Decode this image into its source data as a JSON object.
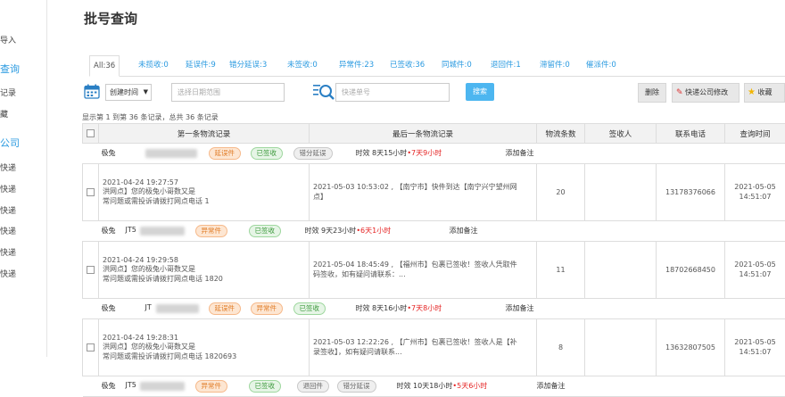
{
  "sidebar": {
    "items": [
      {
        "label": "导入",
        "type": "item"
      },
      {
        "label": "查询",
        "type": "head"
      },
      {
        "label": "记录",
        "type": "item"
      },
      {
        "label": "藏",
        "type": "item"
      },
      {
        "label": "公司",
        "type": "head"
      },
      {
        "label": "快递",
        "type": "item"
      },
      {
        "label": "快递",
        "type": "item"
      },
      {
        "label": "快递",
        "type": "item"
      },
      {
        "label": "快递",
        "type": "item"
      },
      {
        "label": "快递",
        "type": "item"
      },
      {
        "label": "快递",
        "type": "item"
      }
    ]
  },
  "page_title": "批号查询",
  "tabs": [
    {
      "label": "All:36",
      "active": true
    },
    {
      "label": "未揽收:0"
    },
    {
      "label": "延误件:9"
    },
    {
      "label": "错分延误:3"
    },
    {
      "label": "未签收:0"
    },
    {
      "label": "异常件:23"
    },
    {
      "label": "已签收:36"
    },
    {
      "label": "同城件:0"
    },
    {
      "label": "退回件:1"
    },
    {
      "label": "滞留件:0"
    },
    {
      "label": "催派件:0"
    }
  ],
  "toolbar": {
    "date_select": "创建时间",
    "date_placeholder": "选择日期范围",
    "tracking_placeholder": "快递单号",
    "search_label": "搜索",
    "delete_label": "删除",
    "edit_courier_label": "快递公司修改",
    "favorite_label": "收藏"
  },
  "info_text": "显示第 1 到第 36 条记录，总共 36 条记录",
  "table": {
    "headers": [
      "第一条物流记录",
      "最后一条物流记录",
      "物流条数",
      "签收人",
      "联系电话",
      "查询时间"
    ],
    "groups": [
      {
        "courier": "极兔",
        "tracking_prefix": "",
        "badges": [
          {
            "label": "延误件",
            "style": "orange"
          },
          {
            "label": "已签收",
            "style": "green"
          },
          {
            "label": "错分延误",
            "style": "gray"
          }
        ],
        "timing_prefix": "时效 8天15小时",
        "timing_delay": "•7天9小时",
        "add_note": "添加备注",
        "first_record": [
          "2021-04-24 19:27:57",
          "洪网点】您的极兔小哥数又是",
          "常问题或需投诉请拨打网点电话 1"
        ],
        "last_record": [
          "2021-05-03 10:53:02 , 【南宁市】快件到达【南宁兴宁望州网",
          "点】"
        ],
        "count": "20",
        "signer": "",
        "phone": "13178376066",
        "query_time": [
          "2021-05-05",
          "14:51:07"
        ]
      },
      {
        "courier": "极兔",
        "tracking_prefix": "JT5",
        "badges": [
          {
            "label": "异常件",
            "style": "orange"
          },
          {
            "label": "已签收",
            "style": "green"
          }
        ],
        "timing_prefix": "时效 9天23小时",
        "timing_delay": "•6天1小时",
        "add_note": "添加备注",
        "first_record": [
          "2021-04-24 19:29:58",
          "洪网点】您的极兔小哥数又是",
          "常问题或需投诉请拨打网点电话 1820"
        ],
        "last_record": [
          "2021-05-04 18:45:49 , 【福州市】包裹已签收！签收人凭取件",
          "码签收，如有疑问请联系：..."
        ],
        "count": "11",
        "signer": "",
        "phone": "18702668450",
        "query_time": [
          "2021-05-05",
          "14:51:07"
        ]
      },
      {
        "courier": "极兔",
        "tracking_prefix": "JT",
        "badges": [
          {
            "label": "延误件",
            "style": "orange"
          },
          {
            "label": "异常件",
            "style": "orange"
          },
          {
            "label": "已签收",
            "style": "green"
          }
        ],
        "timing_prefix": "时效 8天16小时",
        "timing_delay": "•7天8小时",
        "add_note": "添加备注",
        "first_record": [
          "2021-04-24 19:28:31",
          "洪网点】您的极兔小哥数又是",
          "常问题或需投诉请拨打网点电话 1820693"
        ],
        "last_record": [
          "2021-05-03 12:22:26 , 【广州市】包裹已签收！签收人是【补",
          "录签收】，如有疑问请联系..."
        ],
        "count": "8",
        "signer": "",
        "phone": "13632807505",
        "query_time": [
          "2021-05-05",
          "14:51:07"
        ]
      },
      {
        "courier": "极兔",
        "tracking_prefix": "JT5",
        "badges": [
          {
            "label": "异常件",
            "style": "orange"
          },
          {
            "label": "已签收",
            "style": "green"
          },
          {
            "label": "退回件",
            "style": "gray"
          },
          {
            "label": "错分延误",
            "style": "gray"
          }
        ],
        "timing_prefix": "时效 10天18小时",
        "timing_delay": "•5天6小时",
        "add_note": "添加备注"
      }
    ]
  },
  "colors": {
    "accent": "#2a9ae0",
    "search_button": "#4db6f0",
    "delay_red": "#e52222"
  }
}
